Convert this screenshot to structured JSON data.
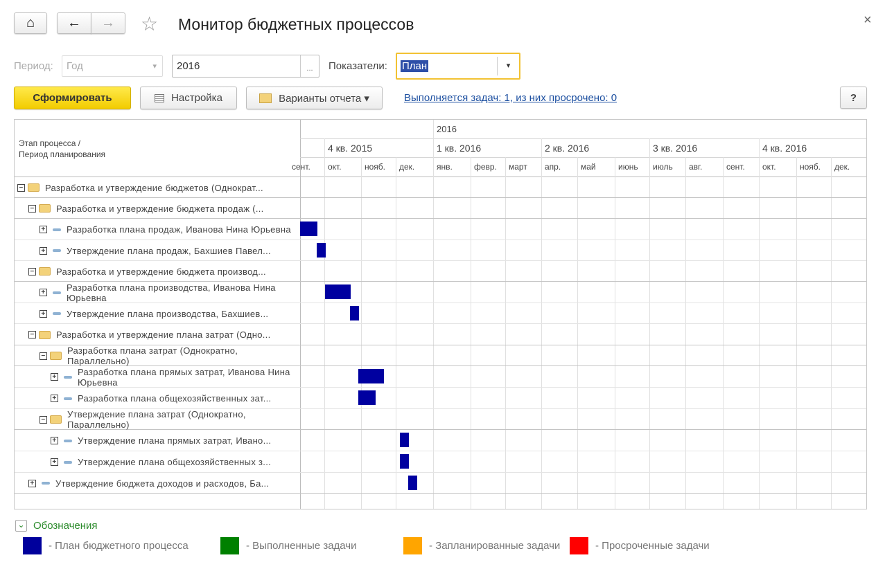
{
  "window": {
    "title": "Монитор бюджетных процессов",
    "close": "×"
  },
  "nav": {
    "home": "⌂",
    "back": "←",
    "forward": "→",
    "favorite": "☆"
  },
  "filters": {
    "period_label": "Период:",
    "period_value": "Год",
    "year_value": "2016",
    "year_button": "...",
    "indicators_label": "Показатели:",
    "indicators_value": "План",
    "dropdown": "▾"
  },
  "toolbar": {
    "generate": "Сформировать",
    "settings": "Настройка",
    "variants": "Варианты отчета ▾",
    "tasks_link": "Выполняется задач: 1, из них просрочено: 0",
    "help": "?"
  },
  "table": {
    "header": "Этап процесса /\nПериод планирования",
    "years": [
      "2016"
    ],
    "quarters": [
      "4 кв. 2015",
      "1 кв. 2016",
      "2 кв. 2016",
      "3 кв. 2016",
      "4 кв. 2016"
    ],
    "months": [
      "сент.",
      "окт.",
      "нояб.",
      "дек.",
      "янв.",
      "февр.",
      "март",
      "апр.",
      "май",
      "июнь",
      "июль",
      "авг.",
      "сент.",
      "окт.",
      "нояб.",
      "дек."
    ],
    "rows": [
      {
        "level": 0,
        "type": "folder",
        "toggle": "−",
        "text": "Разработка и утверждение бюджетов (Однократ..."
      },
      {
        "level": 1,
        "type": "folder",
        "toggle": "−",
        "text": "Разработка и утверждение бюджета продаж (..."
      },
      {
        "level": 2,
        "type": "task",
        "toggle": "+",
        "text": "Разработка плана продаж, Иванова Нина Юрьевна",
        "bar": [
          0.33,
          0.81
        ]
      },
      {
        "level": 2,
        "type": "task",
        "toggle": "+",
        "text": "Утверждение плана продаж, Бахшиев Павел...",
        "bar": [
          0.79,
          1.04
        ]
      },
      {
        "level": 1,
        "type": "folder",
        "toggle": "−",
        "text": "Разработка и утверждение бюджета производ..."
      },
      {
        "level": 2,
        "type": "task",
        "toggle": "+",
        "text": "Разработка плана производства, Иванова Нина Юрьевна",
        "bar": [
          1.02,
          1.72
        ]
      },
      {
        "level": 2,
        "type": "task",
        "toggle": "+",
        "text": "Утверждение плана производства, Бахшиев...",
        "bar": [
          1.7,
          1.94
        ]
      },
      {
        "level": 1,
        "type": "folder",
        "toggle": "−",
        "text": "Разработка и утверждение плана затрат (Одно..."
      },
      {
        "level": 2,
        "type": "folder",
        "toggle": "−",
        "text": "Разработка плана затрат (Однократно, Параллельно)"
      },
      {
        "level": 3,
        "type": "task",
        "toggle": "+",
        "text": "Разработка плана прямых затрат, Иванова Нина Юрьевна",
        "bar": [
          1.92,
          2.66
        ]
      },
      {
        "level": 3,
        "type": "task",
        "toggle": "+",
        "text": "Разработка плана общехозяйственных зат...",
        "bar": [
          1.92,
          2.42
        ]
      },
      {
        "level": 2,
        "type": "folder",
        "toggle": "−",
        "text": "Утверждение плана затрат (Однократно, Параллельно)"
      },
      {
        "level": 3,
        "type": "task",
        "toggle": "+",
        "text": "Утверждение плана прямых затрат, Ивано...",
        "bar": [
          3.11,
          3.35
        ]
      },
      {
        "level": 3,
        "type": "task",
        "toggle": "+",
        "text": "Утверждение плана общехозяйственных з...",
        "bar": [
          3.11,
          3.35
        ]
      },
      {
        "level": 1,
        "type": "task",
        "toggle": "+",
        "text": "Утверждение бюджета доходов и расходов, Ба...",
        "bar": [
          3.33,
          3.57
        ]
      }
    ]
  },
  "legend": {
    "toggle": "⌄",
    "title": "Обозначения",
    "items": [
      {
        "label": "- План бюджетного процесса",
        "color": "#00009c"
      },
      {
        "label": "- Выполненные задачи",
        "color": "#008000"
      },
      {
        "label": "- Запланированные задачи",
        "color": "#ffa500"
      },
      {
        "label": "- Просроченные задачи",
        "color": "#ff0000"
      }
    ]
  }
}
